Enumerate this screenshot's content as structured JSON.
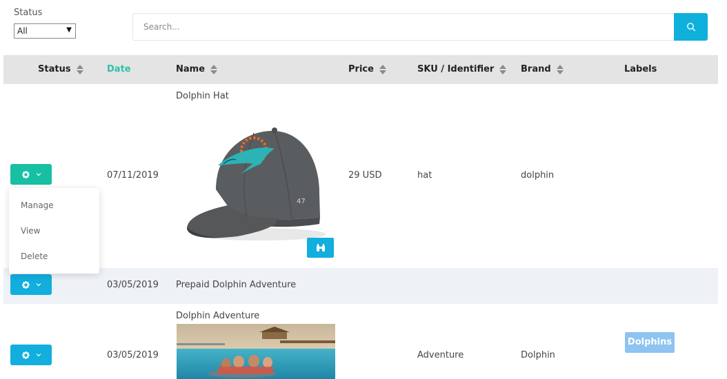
{
  "filters": {
    "status_label": "Status",
    "status_selected": "All",
    "search_placeholder": "Search..."
  },
  "table": {
    "headers": {
      "status": "Status",
      "date": "Date",
      "name": "Name",
      "price": "Price",
      "sku": "SKU / Identifier",
      "brand": "Brand",
      "labels": "Labels"
    },
    "rows": [
      {
        "date": "07/11/2019",
        "name": "Dolphin Hat",
        "price": "29 USD",
        "sku": "hat",
        "brand": "dolphin",
        "label": ""
      },
      {
        "date": "03/05/2019",
        "name": "Prepaid Dolphin Adventure",
        "price": "",
        "sku": "",
        "brand": "",
        "label": ""
      },
      {
        "date": "03/05/2019",
        "name": "Dolphin Adventure",
        "price": "",
        "sku": "Adventure",
        "brand": "Dolphin",
        "label": "Dolphins"
      }
    ]
  },
  "action_menu": {
    "items": [
      "Manage",
      "View",
      "Delete"
    ]
  },
  "colors": {
    "teal": "#17c0a3",
    "blue": "#11aede",
    "header_bg": "#e4e4e4",
    "active_sort": "#2dc2a5",
    "label_badge": "#8ec3f2"
  },
  "icons": {
    "search": "search-icon",
    "gear": "gear-icon",
    "chevron": "chevron-down-icon",
    "zoom": "binoculars-icon",
    "sort": "sort-icon"
  }
}
